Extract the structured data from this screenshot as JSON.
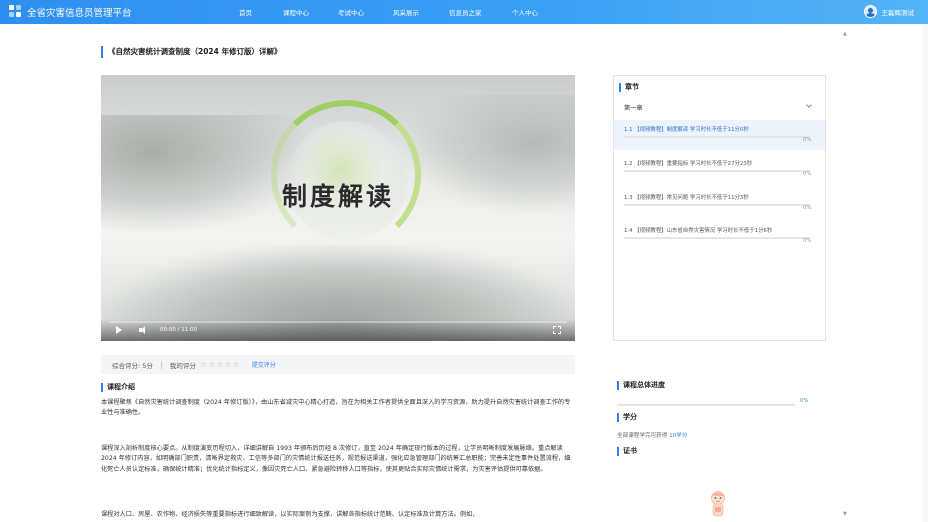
{
  "app": {
    "brand": "全省灾害信息员管理平台",
    "nav": [
      "首页",
      "课程中心",
      "考试中心",
      "风采展示",
      "信息员之家",
      "个人中心"
    ],
    "user_name": "王磊辉测试"
  },
  "course": {
    "title": "《自然灾害统计调查制度（2024 年修订版）详解》",
    "video": {
      "slogan": "制度解读",
      "time": "00:00 / 11:00"
    },
    "rating": {
      "overall": "综合评分: 5分",
      "mine_label": "我的评分",
      "stars": [
        "☆",
        "☆",
        "☆",
        "☆",
        "☆"
      ],
      "submit": "提交评分"
    },
    "intro_title": "课程介绍",
    "intro_paragraphs": [
      "本课程聚焦《自然灾害统计调查制度（2024 年修订版）》，由山东省减灾中心精心打造，旨在为相关工作者提供全面且深入的学习资源，助力提升自然灾害统计调查工作的专业性与准确性。",
      "课程深入剖析制度核心要点。从制度演变历程切入，详细讲解自 1993 年颁布后历经 8 次修订，直至 2024 年确定现行版本的过程，让学员明晰制度发展脉络。重点解读 2024 年修订内容，如明确部门职责，清晰界定救灾、工信等多部门的灾情统计报送任务，规范报送渠道，强化应急管理部门的统筹汇总职能；完善未定性事件处置流程，细化死亡人员认定标准，确保统计精准；优化统计指标定义，像因灾死亡人口、紧急避险转移人口等指标，使其更贴合实际灾情统计需求，为灾害评估提供可靠依据。",
      "课程对人口、房屋、农作物、经济损失等重要指标进行细致解读，以实际案例为支撑，讲解各指标统计范畴、认定标准及计算方法。例如，"
    ]
  },
  "chapters": {
    "title": "章节",
    "group": "第一章",
    "lessons": [
      {
        "label": "1.1 【视频教程】制度解读 学习时长不低于11分0秒",
        "pct": "0%",
        "progress": 0
      },
      {
        "label": "1.2 【视频教程】重要指标 学习时长不低于27分23秒",
        "pct": "0%",
        "progress": 0
      },
      {
        "label": "1.3 【视频教程】常见问题 学习时长不低于11分3秒",
        "pct": "0%",
        "progress": 0
      },
      {
        "label": "1.4 【视频教程】山东省自然灾害情况 学习时长不低于1分6秒",
        "pct": "0%",
        "progress": 0
      }
    ]
  },
  "progress": {
    "title": "课程总体进度",
    "pct": "0%",
    "value": 0
  },
  "credit": {
    "title": "学分",
    "prefix": "全部课程学完可获得 ",
    "amount": "10学分"
  },
  "certificate": {
    "title": "证书"
  },
  "colors": {
    "header": "#2f8ff0",
    "accent": "#2f80ed",
    "active_row": "#edf4fd",
    "progress_text": "#3aa66a"
  },
  "icons": {
    "logo": "four-square-logo-icon",
    "avatar": "user-avatar-icon",
    "play": "play-icon",
    "volume": "volume-icon",
    "fullscreen": "fullscreen-icon",
    "chevron": "chevron-down-icon",
    "mascot": "mascot-icon"
  }
}
